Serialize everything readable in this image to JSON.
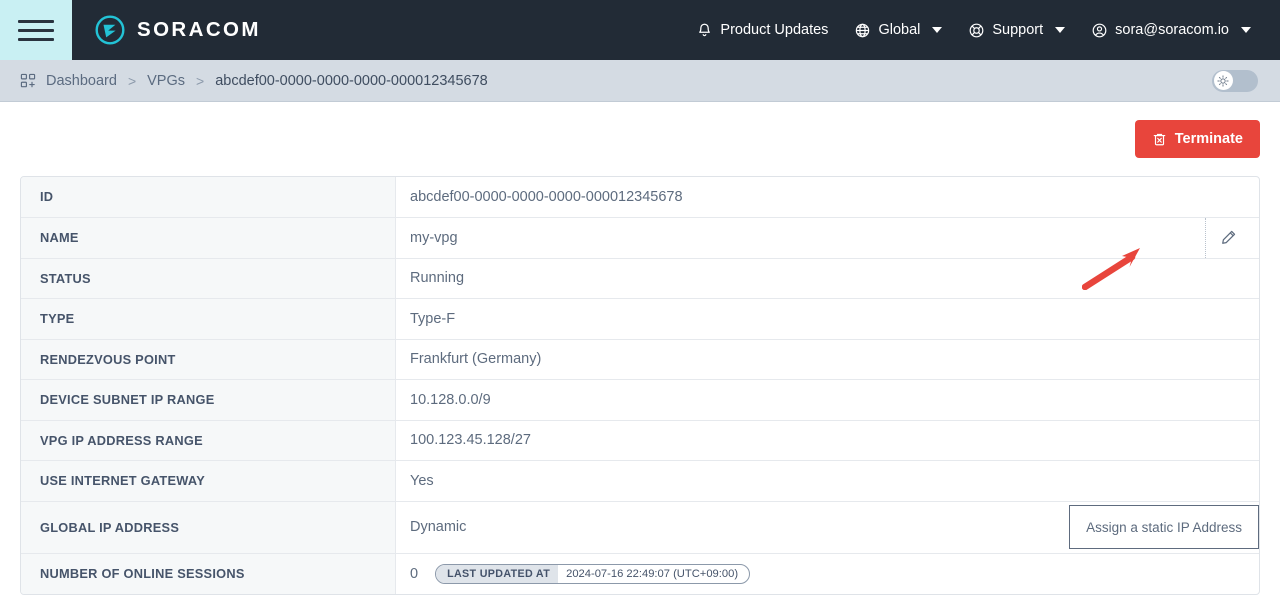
{
  "header": {
    "menu_icon": "hamburger-icon",
    "brand": "SORACOM",
    "nav": [
      {
        "label": "Product Updates",
        "icon": "bell-icon",
        "caret": false
      },
      {
        "label": "Global",
        "icon": "globe-icon",
        "caret": true
      },
      {
        "label": "Support",
        "icon": "lifebuoy-icon",
        "caret": true
      },
      {
        "label": "sora@soracom.io",
        "icon": "user-circle-icon",
        "caret": true
      }
    ]
  },
  "breadcrumb": {
    "icon": "dashboard-grid-icon",
    "separator": ">",
    "items": [
      {
        "label": "Dashboard"
      },
      {
        "label": "VPGs"
      },
      {
        "label": "abcdef00-0000-0000-0000-000012345678"
      }
    ],
    "theme_toggle": {
      "icon": "sun-icon",
      "state": "off"
    }
  },
  "actions": {
    "terminate": {
      "label": "Terminate",
      "icon": "trash-icon",
      "color": "#e8453c"
    },
    "annotation_arrow": {
      "color": "#e8453c",
      "direction": "up-right"
    }
  },
  "details": {
    "rows": [
      {
        "label": "ID",
        "value": "abcdef00-0000-0000-0000-000012345678"
      },
      {
        "label": "NAME",
        "value": "my-vpg",
        "edit_icon": "pencil-icon"
      },
      {
        "label": "STATUS",
        "value": "Running"
      },
      {
        "label": "TYPE",
        "value": "Type-F"
      },
      {
        "label": "RENDEZVOUS POINT",
        "value": "Frankfurt (Germany)"
      },
      {
        "label": "DEVICE SUBNET IP RANGE",
        "value": "10.128.0.0/9"
      },
      {
        "label": "VPG IP ADDRESS RANGE",
        "value": "100.123.45.128/27"
      },
      {
        "label": "USE INTERNET GATEWAY",
        "value": "Yes"
      },
      {
        "label": "GLOBAL IP ADDRESS",
        "value": "Dynamic",
        "button": "Assign a static IP Address"
      },
      {
        "label": "NUMBER OF ONLINE SESSIONS",
        "value": "0",
        "badge": {
          "label": "LAST UPDATED AT",
          "value": "2024-07-16 22:49:07 (UTC+09:00)"
        }
      }
    ]
  }
}
